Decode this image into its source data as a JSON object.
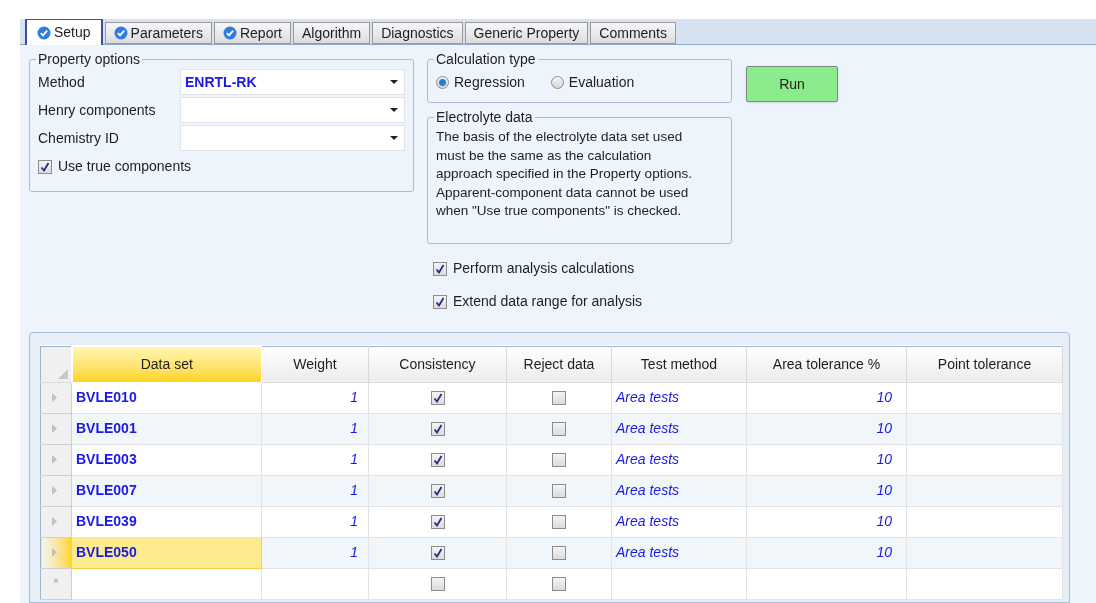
{
  "tabs": [
    {
      "label": "Setup",
      "selected": true,
      "complete": true
    },
    {
      "label": "Parameters",
      "selected": false,
      "complete": true
    },
    {
      "label": "Report",
      "selected": false,
      "complete": true
    },
    {
      "label": "Algorithm",
      "selected": false,
      "complete": false
    },
    {
      "label": "Diagnostics",
      "selected": false,
      "complete": false
    },
    {
      "label": "Generic Property",
      "selected": false,
      "complete": false
    },
    {
      "label": "Comments",
      "selected": false,
      "complete": false
    }
  ],
  "property_options": {
    "title": "Property options",
    "fields": [
      {
        "label": "Method",
        "value": "ENRTL-RK"
      },
      {
        "label": "Henry components"
      },
      {
        "label": "Chemistry ID"
      }
    ],
    "use_true_components": {
      "label": "Use true components",
      "checked": true
    }
  },
  "calculation_type": {
    "title": "Calculation type",
    "options": [
      {
        "label": "Regression",
        "selected": true
      },
      {
        "label": "Evaluation",
        "selected": false
      }
    ]
  },
  "run_button": "Run",
  "electrolyte_data": {
    "title": "Electrolyte data",
    "text": "The basis of the electrolyte data set used must be the same as the calculation approach specified in the Property options. Apparent-component data cannot be used when \"Use true components\" is checked."
  },
  "options": [
    {
      "label": "Perform analysis calculations",
      "checked": true
    },
    {
      "label": "Extend data range for analysis",
      "checked": true
    }
  ],
  "table": {
    "columns": [
      "Data set",
      "Weight",
      "Consistency",
      "Reject data",
      "Test method",
      "Area tolerance %",
      "Point tolerance"
    ],
    "rows": [
      {
        "data_set": "BVLE010",
        "weight": "1",
        "consistency": true,
        "reject_data": false,
        "test_method": "Area tests",
        "area_tolerance": "10",
        "selected": false
      },
      {
        "data_set": "BVLE001",
        "weight": "1",
        "consistency": true,
        "reject_data": false,
        "test_method": "Area tests",
        "area_tolerance": "10",
        "selected": false
      },
      {
        "data_set": "BVLE003",
        "weight": "1",
        "consistency": true,
        "reject_data": false,
        "test_method": "Area tests",
        "area_tolerance": "10",
        "selected": false
      },
      {
        "data_set": "BVLE007",
        "weight": "1",
        "consistency": true,
        "reject_data": false,
        "test_method": "Area tests",
        "area_tolerance": "10",
        "selected": false
      },
      {
        "data_set": "BVLE039",
        "weight": "1",
        "consistency": true,
        "reject_data": false,
        "test_method": "Area tests",
        "area_tolerance": "10",
        "selected": false
      },
      {
        "data_set": "BVLE050",
        "weight": "1",
        "consistency": true,
        "reject_data": false,
        "test_method": "Area tests",
        "area_tolerance": "10",
        "selected": true
      }
    ],
    "new_row": {
      "marker": "*",
      "consistency": false,
      "reject_data": false
    }
  }
}
